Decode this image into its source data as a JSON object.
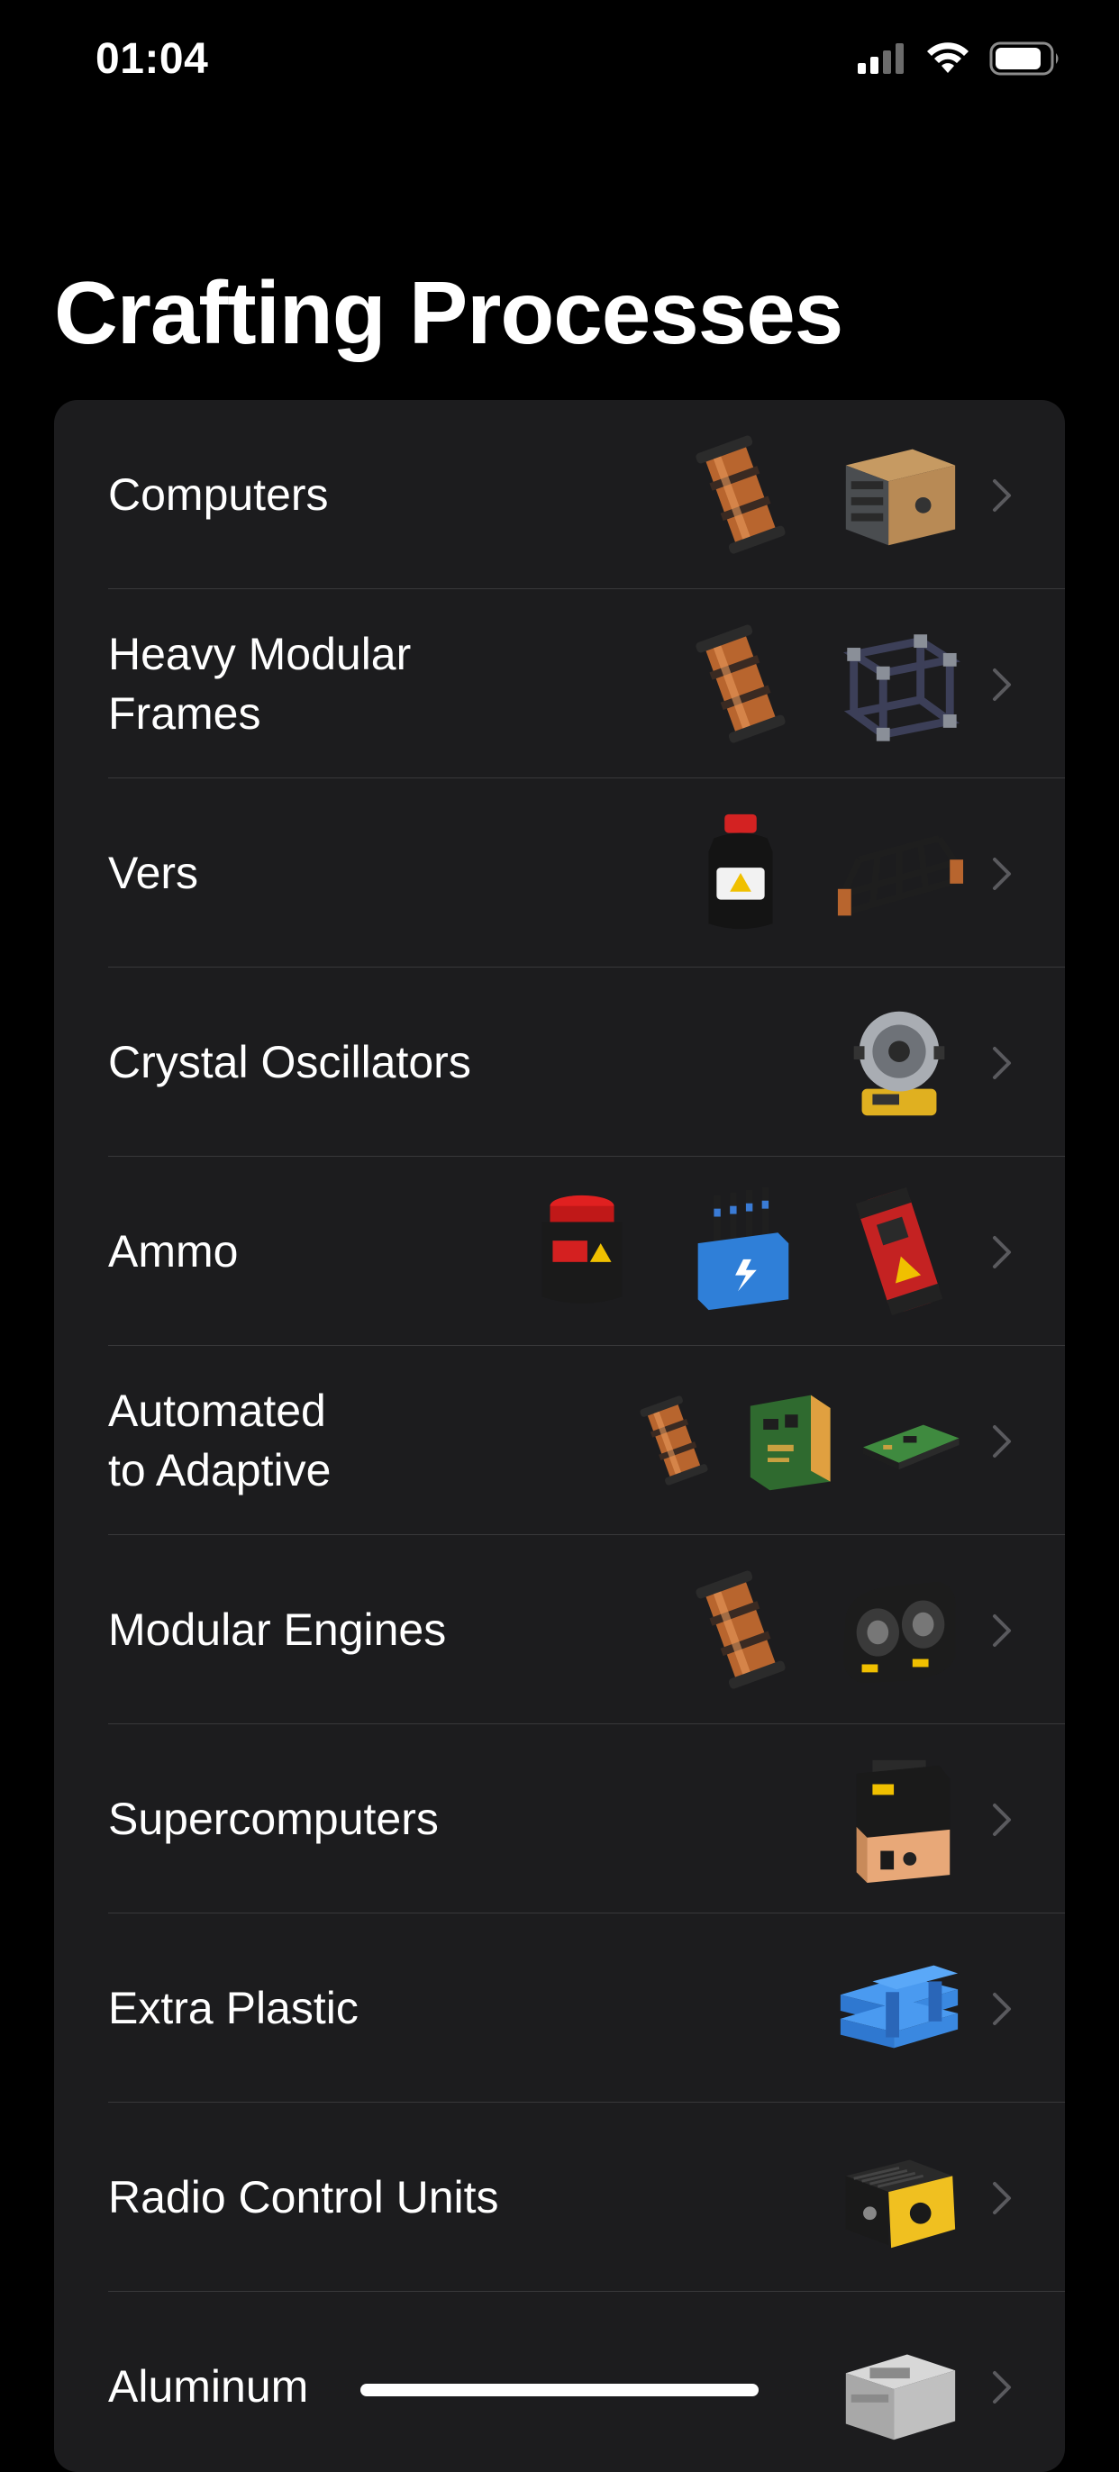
{
  "status_bar": {
    "time": "01:04",
    "icons": [
      "signal-icon",
      "wifi-icon",
      "battery-icon"
    ]
  },
  "title": "Crafting Processes",
  "colors": {
    "background": "#000000",
    "card": "#1c1c1e",
    "separator": "#38383a",
    "chevron": "#5a5a5e"
  },
  "rows": [
    {
      "label": "Computers",
      "icons": [
        "copper-rotor-icon",
        "computer-case-icon"
      ]
    },
    {
      "label": "Heavy Modular\nFrames",
      "icons": [
        "copper-rotor-icon",
        "modular-frame-icon"
      ]
    },
    {
      "label": "Vers",
      "icons": [
        "fuel-bottle-icon",
        "truss-beam-icon"
      ]
    },
    {
      "label": "Crystal Oscillators",
      "icons": [
        "crystal-oscillator-icon"
      ]
    },
    {
      "label": "Ammo",
      "icons": [
        "ammo-canister-icon",
        "battery-rods-icon",
        "rebar-cartridge-icon"
      ]
    },
    {
      "label": "Automated\nto Adaptive",
      "icons": [
        "copper-rotor-icon",
        "circuit-board-icon",
        "control-board-icon"
      ]
    },
    {
      "label": "Modular Engines",
      "icons": [
        "copper-rotor-icon",
        "engine-block-icon"
      ]
    },
    {
      "label": "Supercomputers",
      "icons": [
        "supercomputer-icon"
      ]
    },
    {
      "label": "Extra Plastic",
      "icons": [
        "plastic-sheets-icon"
      ]
    },
    {
      "label": "Radio Control Units",
      "icons": [
        "radio-control-unit-icon"
      ]
    },
    {
      "label": "Aluminum",
      "icons": [
        "aluminum-casing-icon"
      ]
    }
  ]
}
